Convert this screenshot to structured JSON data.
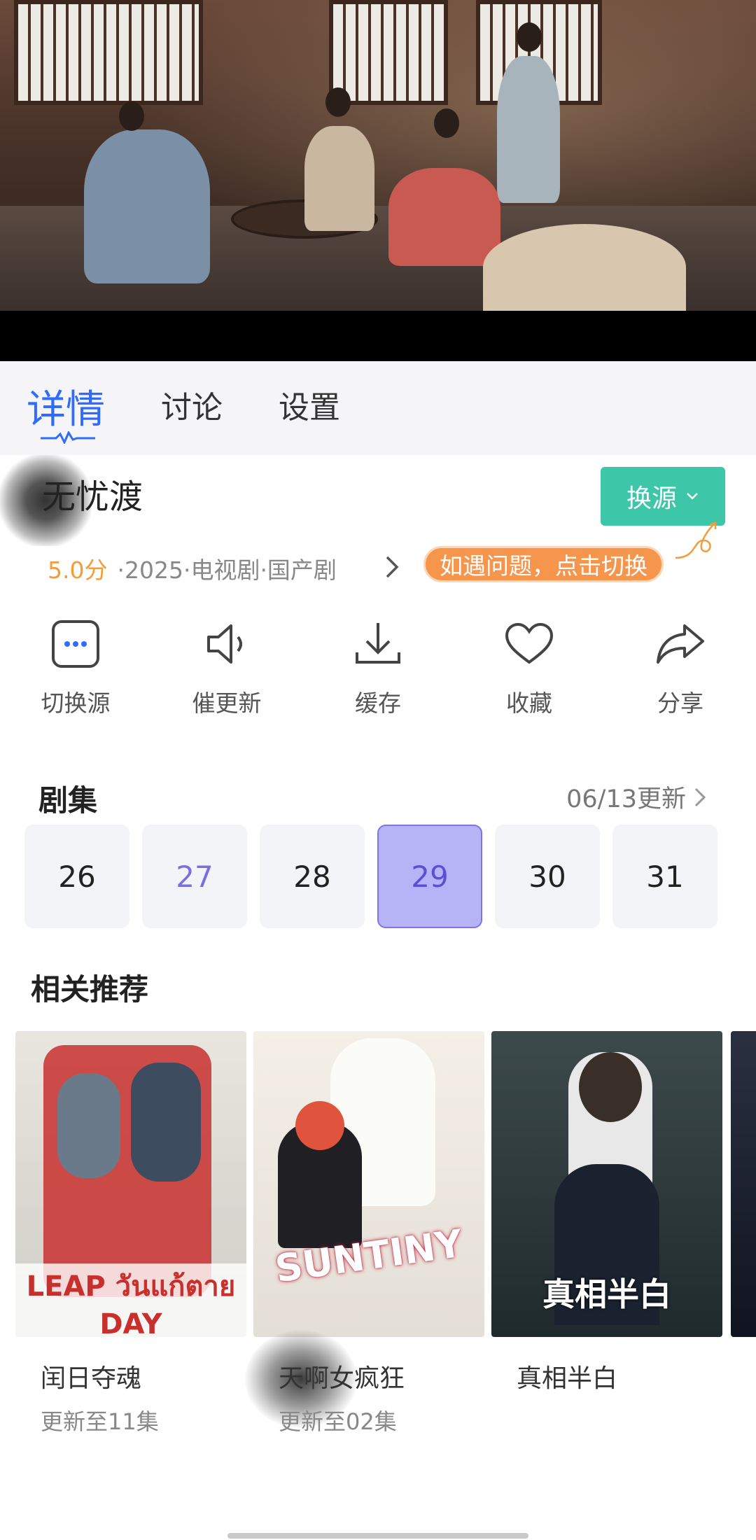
{
  "tabs": {
    "details": "详情",
    "discussion": "讨论",
    "settings": "设置"
  },
  "show": {
    "title": "无忧渡",
    "score": "5.0分",
    "meta": "·2025·电视剧·国产剧",
    "switch_source_button": "换源",
    "tip": "如遇问题，点击切换"
  },
  "actions": [
    {
      "label": "切换源",
      "icon": "more-dots-icon"
    },
    {
      "label": "催更新",
      "icon": "speaker-icon"
    },
    {
      "label": "缓存",
      "icon": "download-icon"
    },
    {
      "label": "收藏",
      "icon": "heart-icon"
    },
    {
      "label": "分享",
      "icon": "share-icon"
    }
  ],
  "episodes": {
    "title": "剧集",
    "update": "06/13更新",
    "items": [
      "26",
      "27",
      "28",
      "29",
      "30",
      "31"
    ]
  },
  "recommend": {
    "title": "相关推荐",
    "items": [
      {
        "title": "闰日夺魂",
        "subtitle": "更新至11集",
        "poster_text": "LEAP วันแก้ตาย DAY"
      },
      {
        "title": "天啊女疯狂",
        "subtitle": "更新至02集",
        "poster_text": "SUNTINY"
      },
      {
        "title": "真相半白",
        "subtitle": "",
        "poster_text": "真相半白"
      }
    ]
  },
  "colors": {
    "accent_blue": "#2f6bff",
    "switch_green": "#3dc7a8",
    "score_orange": "#f39c3a",
    "current_episode": "#b6b3f7"
  }
}
